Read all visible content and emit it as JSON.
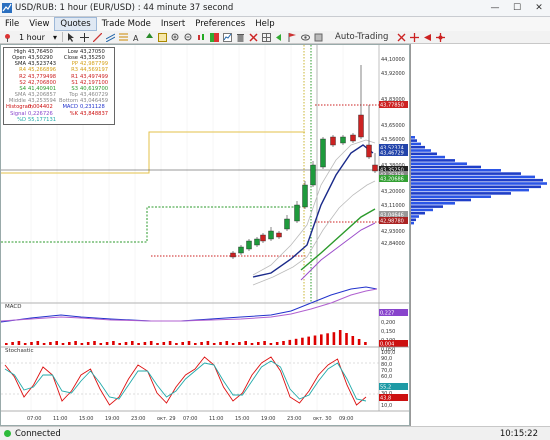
{
  "window": {
    "title": "USD/RUB: 1 hour (EUR/USD) : 44 minute 37 second",
    "minimize_label": "—",
    "maximize_label": "☐",
    "close_label": "✕"
  },
  "menu": [
    "File",
    "View",
    "Quotes",
    "Trade Mode",
    "Insert",
    "Preferences",
    "Help"
  ],
  "toolbar": {
    "timeframe": "1 hour",
    "auto_trading": "Auto-Trading",
    "icons": [
      "pointer-icon",
      "crosshair-icon",
      "line-icon",
      "channel-icon",
      "fibonacci-icon",
      "text-icon",
      "arrow-icon",
      "properties-icon",
      "zoom-in-icon",
      "zoom-out-icon",
      "chart-type-icon",
      "color-icon",
      "indicator-icon",
      "delete-icon",
      "close-chart-icon",
      "grid-icon",
      "auto-scroll-icon",
      "flag-icon",
      "eye-icon",
      "tools-icon"
    ]
  },
  "info_panel": {
    "rows": [
      [
        "High",
        "43,76450",
        "Low",
        "43,27050"
      ],
      [
        "Open",
        "43,50290",
        "Close",
        "43,35250"
      ],
      [
        "SMA",
        "43,523743",
        "PP",
        "42,987799"
      ],
      [
        "R4",
        "45,266896",
        "R3",
        "44,569197"
      ],
      [
        "R2",
        "43,779498",
        "R1",
        "43,497499"
      ],
      [
        "S2",
        "42,706800",
        "S1",
        "42,197100"
      ],
      [
        "S4",
        "41,409401",
        "S3",
        "40,619700"
      ],
      [
        "SMA",
        "43,206857",
        "Top",
        "43,460729"
      ],
      [
        "Middle",
        "43,253594",
        "Bottom",
        "43,046459"
      ],
      [
        "Histogram",
        "0,004402",
        "MACD",
        "0,231128"
      ],
      [
        "Signal",
        "0,226726",
        "%K",
        "43,848837"
      ],
      [
        "%D",
        "55,177131",
        "",
        ""
      ]
    ]
  },
  "price_axis": {
    "labels": [
      "44,10000",
      "43,92000",
      "43,83000",
      "43,65000",
      "43,56000",
      "43,47000",
      "43,38000",
      "43,20000",
      "43,11000",
      "42,93000",
      "42,84000"
    ],
    "badges": [
      {
        "text": "43,77850",
        "color": "#cc2222"
      },
      {
        "text": "43,52374",
        "color": "#2244aa"
      },
      {
        "text": "43,46729",
        "color": "#2244aa"
      },
      {
        "text": "43,35250",
        "color": "#222222"
      },
      {
        "text": "43,25359",
        "color": "#888888"
      },
      {
        "text": "43,20686",
        "color": "#33a033"
      },
      {
        "text": "43,04646",
        "color": "#999999"
      },
      {
        "text": "42,98780",
        "color": "#aa2222"
      }
    ]
  },
  "macd_panel": {
    "label": "MACD",
    "axis_labels": [
      "0,250",
      "0,200",
      "0,150",
      "0,100",
      "0,050"
    ],
    "badges": [
      {
        "text": "0,227",
        "color": "#8844cc"
      },
      {
        "text": "0,004",
        "color": "#cc1111"
      }
    ]
  },
  "stoch_panel": {
    "label": "Stochastic",
    "axis_labels": [
      "100,0",
      "90,0",
      "80,0",
      "70,0",
      "60,0",
      "40,0",
      "30,0",
      "20,0",
      "10,0"
    ],
    "badges": [
      {
        "text": "55,2",
        "color": "#1e9aa5"
      },
      {
        "text": "43,8",
        "color": "#cc1111"
      }
    ]
  },
  "time_axis": [
    "07:00",
    "11:00",
    "15:00",
    "19:00",
    "23:00",
    "окт. 29",
    "07:00",
    "11:00",
    "15:00",
    "19:00",
    "23:00",
    "окт. 30",
    "09:00"
  ],
  "status": {
    "text": "Connected",
    "time": "10:15:22"
  },
  "colors": {
    "background": "#ffffff",
    "bull_candle": "#1e9a3c",
    "bear_candle": "#cc2222",
    "sma": "#1a2a8a",
    "bollinger": "#aaaaaa",
    "pivot_r": "#d4a017",
    "pivot_s": "#2b9a2b",
    "macd_line": "#2233cc",
    "signal_line": "#b060d0",
    "histogram": "#dd0000",
    "stoch_k": "#dd1111",
    "stoch_d": "#22aaaa"
  }
}
